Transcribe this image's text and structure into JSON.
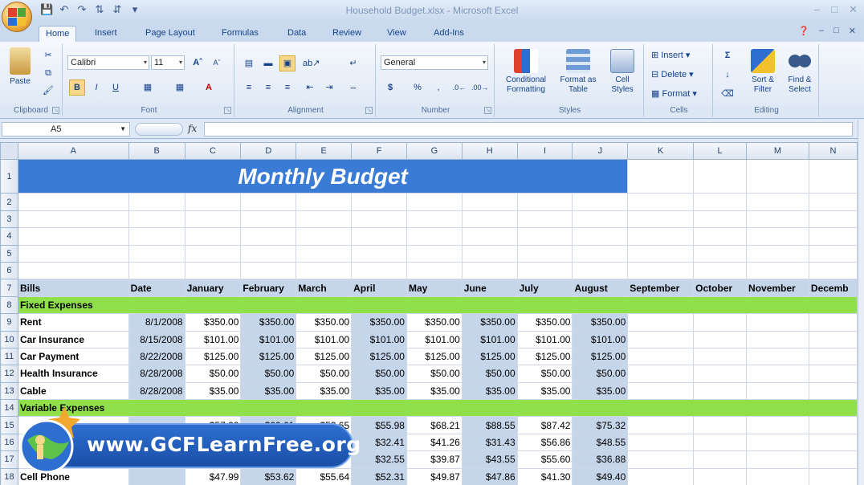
{
  "window": {
    "title": "Household Budget.xlsx - Microsoft Excel"
  },
  "tabs": [
    "Home",
    "Insert",
    "Page Layout",
    "Formulas",
    "Data",
    "Review",
    "View",
    "Add-Ins"
  ],
  "ribbon": {
    "clipboard": {
      "paste": "Paste",
      "label": "Clipboard"
    },
    "font": {
      "name": "Calibri",
      "size": "11",
      "label": "Font"
    },
    "alignment": {
      "label": "Alignment"
    },
    "number": {
      "format": "General",
      "label": "Number"
    },
    "styles": {
      "conditional": "Conditional Formatting",
      "format_table": "Format as Table",
      "cell_styles": "Cell Styles",
      "label": "Styles"
    },
    "cells": {
      "insert": "Insert",
      "delete": "Delete",
      "format": "Format",
      "label": "Cells"
    },
    "editing": {
      "sort": "Sort & Filter",
      "find": "Find & Select",
      "label": "Editing"
    }
  },
  "formula_bar": {
    "name_box": "A5",
    "fx": "fx"
  },
  "sheet": {
    "columns": [
      "A",
      "B",
      "C",
      "D",
      "E",
      "F",
      "G",
      "H",
      "I",
      "J",
      "K",
      "L",
      "M",
      "N"
    ],
    "title": "Monthly Budget",
    "headers": [
      "Bills",
      "Date",
      "January",
      "February",
      "March",
      "April",
      "May",
      "June",
      "July",
      "August",
      "September",
      "October",
      "November",
      "Decemb"
    ],
    "fixed_label": "Fixed Expenses",
    "fixed": [
      {
        "bill": "Rent",
        "date": "8/1/2008",
        "vals": [
          "$350.00",
          "$350.00",
          "$350.00",
          "$350.00",
          "$350.00",
          "$350.00",
          "$350.00",
          "$350.00"
        ]
      },
      {
        "bill": "Car Insurance",
        "date": "8/15/2008",
        "vals": [
          "$101.00",
          "$101.00",
          "$101.00",
          "$101.00",
          "$101.00",
          "$101.00",
          "$101.00",
          "$101.00"
        ]
      },
      {
        "bill": "Car Payment",
        "date": "8/22/2008",
        "vals": [
          "$125.00",
          "$125.00",
          "$125.00",
          "$125.00",
          "$125.00",
          "$125.00",
          "$125.00",
          "$125.00"
        ]
      },
      {
        "bill": "Health Insurance",
        "date": "8/28/2008",
        "vals": [
          "$50.00",
          "$50.00",
          "$50.00",
          "$50.00",
          "$50.00",
          "$50.00",
          "$50.00",
          "$50.00"
        ]
      },
      {
        "bill": "Cable",
        "date": "8/28/2008",
        "vals": [
          "$35.00",
          "$35.00",
          "$35.00",
          "$35.00",
          "$35.00",
          "$35.00",
          "$35.00",
          "$35.00"
        ]
      }
    ],
    "variable_label": "Variable Expenses",
    "variable": [
      {
        "bill": "",
        "date": "",
        "vals": [
          "$57.22",
          "$69.61",
          "$52.65",
          "$55.98",
          "$68.21",
          "$88.55",
          "$87.42",
          "$75.32"
        ]
      },
      {
        "bill": "",
        "date": "",
        "vals": [
          "",
          "",
          "",
          "$32.41",
          "$41.26",
          "$31.43",
          "$56.86",
          "$48.55"
        ]
      },
      {
        "bill": "",
        "date": "",
        "vals": [
          "",
          "",
          "",
          "$32.55",
          "$39.87",
          "$43.55",
          "$55.60",
          "$36.88"
        ]
      },
      {
        "bill": "Cell Phone",
        "date": "",
        "vals": [
          "$47.99",
          "$53.62",
          "$55.64",
          "$52.31",
          "$49.87",
          "$47.86",
          "$41.30",
          "$49.40"
        ]
      }
    ]
  },
  "watermark": {
    "text": "www.GCFLearnFree.org"
  }
}
